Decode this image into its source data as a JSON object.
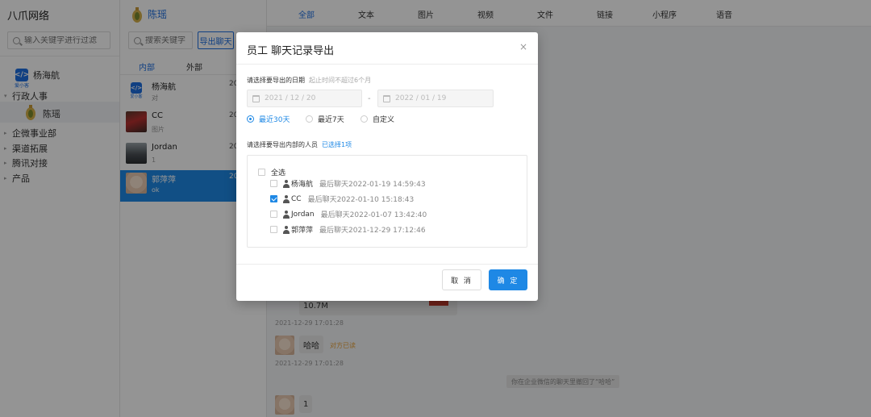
{
  "app": {
    "title": "八爪网络"
  },
  "left_panel": {
    "search_placeholder": "输入关键字进行过滤",
    "corp_name": "杨海航",
    "corp_logo_text": "</>",
    "corp_logo_sub": "爱小客",
    "tree": [
      {
        "label": "行政人事",
        "expanded": true
      },
      {
        "label": "企微事业部",
        "expanded": false
      },
      {
        "label": "渠道拓展",
        "expanded": false
      },
      {
        "label": "腾讯对接",
        "expanded": false
      },
      {
        "label": "产品",
        "expanded": false
      }
    ],
    "selected_member": "陈瑶"
  },
  "chat_list": {
    "header_name": "陈瑶",
    "search_placeholder": "搜索关键字",
    "export_button": "导出聊天",
    "scope_tabs": [
      {
        "label": "内部",
        "active": true
      },
      {
        "label": "外部",
        "active": false
      }
    ],
    "items": [
      {
        "name": "杨海航",
        "preview": "对",
        "time": "20",
        "avatar": "corp-logo"
      },
      {
        "name": "CC",
        "preview": "图片",
        "time": "20",
        "avatar": "photo-red"
      },
      {
        "name": "Jordan",
        "preview": "1",
        "time": "20",
        "avatar": "photo-dark"
      },
      {
        "name": "郭萍萍",
        "preview": "ok",
        "time": "20",
        "avatar": "photo-cream",
        "selected": true
      }
    ]
  },
  "message_tabs": [
    {
      "label": "全部",
      "active": true
    },
    {
      "label": "文本"
    },
    {
      "label": "图片"
    },
    {
      "label": "视频"
    },
    {
      "label": "文件"
    },
    {
      "label": "链接"
    },
    {
      "label": "小程序"
    },
    {
      "label": "语音"
    }
  ],
  "messages": {
    "file_size": "10.7M",
    "ts1": "2021-12-29 17:01:28",
    "hello": "哈哈",
    "read_status": "对方已读",
    "ts2": "2021-12-29 17:01:28",
    "recall_note": "你在企业微信的聊天里撤回了“哈哈”",
    "last_msg": "1"
  },
  "modal": {
    "title": "员工 聊天记录导出",
    "close_symbol": "×",
    "date_label": "请选择要导出的日期",
    "date_hint": "起止时间不超过6个月",
    "start_date": "2021 / 12 / 20",
    "end_date": "2022 / 01 / 19",
    "date_separator": "-",
    "ranges": [
      {
        "label": "最近30天",
        "checked": true
      },
      {
        "label": "最近7天",
        "checked": false
      },
      {
        "label": "自定义",
        "checked": false
      }
    ],
    "member_label": "请选择要导出内部的人员",
    "member_selected": "已选择1项",
    "select_all": "全选",
    "members": [
      {
        "name": "杨海航",
        "last": "最后聊天2022-01-19 14:59:43",
        "checked": false
      },
      {
        "name": "CC",
        "last": "最后聊天2022-01-10 15:18:43",
        "checked": true
      },
      {
        "name": "Jordan",
        "last": "最后聊天2022-01-07 13:42:40",
        "checked": false
      },
      {
        "name": "郭萍萍",
        "last": "最后聊天2021-12-29 17:12:46",
        "checked": false
      }
    ],
    "cancel": "取 消",
    "confirm": "确 定"
  },
  "colors": {
    "accent": "#1e88e5",
    "brand": "#1e6fe0",
    "overlay": "rgba(0,0,0,0.42)"
  }
}
